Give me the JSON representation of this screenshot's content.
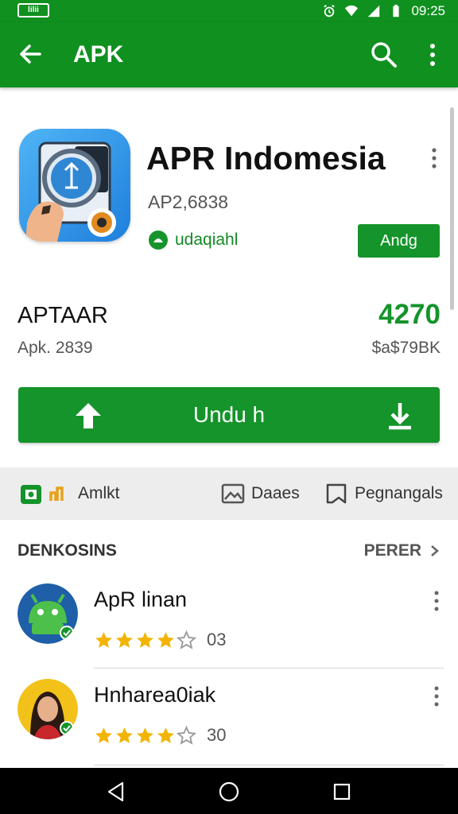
{
  "status_bar": {
    "left_label": "lilii",
    "time": "09:25",
    "icons": [
      "alarm-icon",
      "wifi-icon",
      "signal-icon",
      "battery-icon"
    ]
  },
  "app_bar": {
    "title": "APK",
    "icons": [
      "back-arrow-icon",
      "search-icon",
      "more-vert-icon"
    ]
  },
  "app": {
    "name": "APR Indomesia",
    "id": "AP2,6838",
    "developer": "udaqiahl",
    "install_label": "Andg"
  },
  "stats": {
    "left_top": "APTAAR",
    "left_bottom": "Apk. 2839",
    "right_top": "4270",
    "right_bottom": "$a$79BK"
  },
  "download": {
    "label": "Undu h"
  },
  "tabs": [
    {
      "label": "Amlkt",
      "icon": "photo-icon"
    },
    {
      "label": "Daaes",
      "icon": "image-icon"
    },
    {
      "label": "Pegnangals",
      "icon": "bookmark-icon"
    }
  ],
  "section": {
    "title": "DENKOSINS",
    "more_label": "PERER"
  },
  "list": [
    {
      "name": "ApR linan",
      "rating": 4,
      "count": "03",
      "avatar": "android-avatar"
    },
    {
      "name": "Hnhareа0iak",
      "rating": 4,
      "count": "30",
      "avatar": "person-avatar"
    }
  ],
  "colors": {
    "primary_green": "#10901f",
    "button_green": "#14942a",
    "star_gold": "#f2b400"
  },
  "nav_bar": {
    "icons": [
      "nav-back-icon",
      "nav-home-icon",
      "nav-recents-icon"
    ]
  }
}
